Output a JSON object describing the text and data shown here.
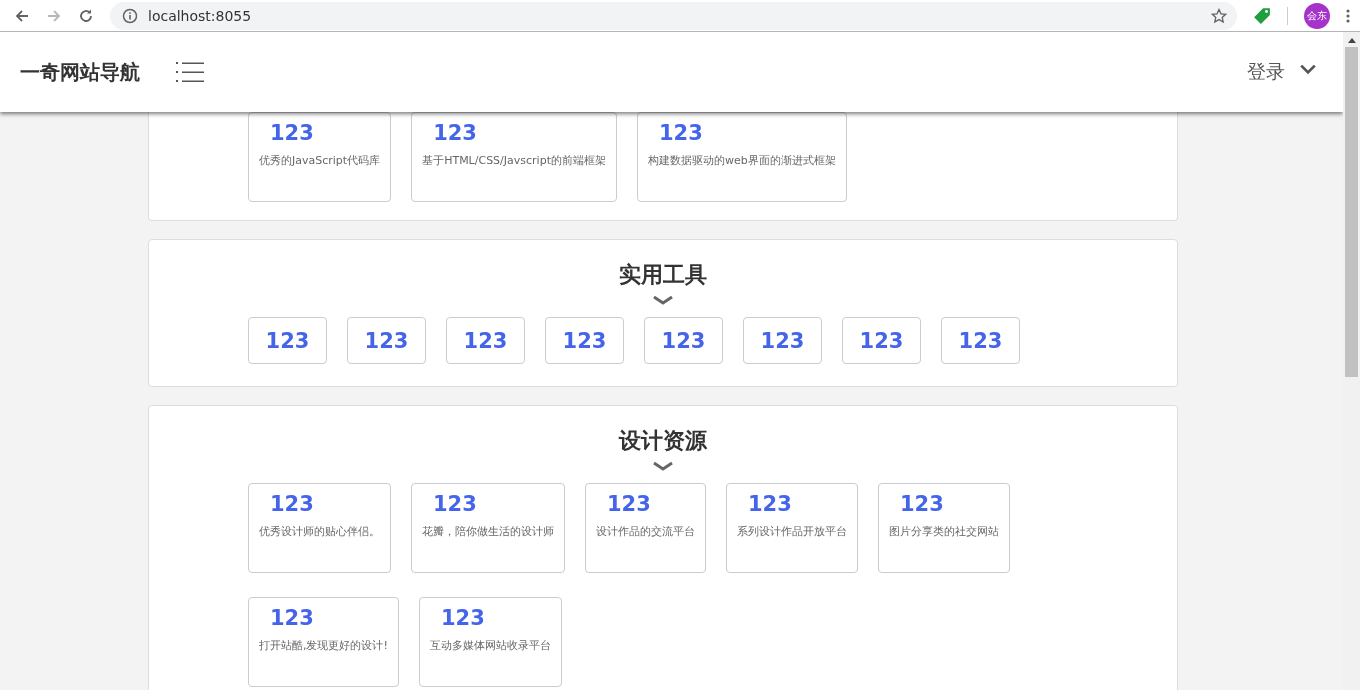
{
  "browser": {
    "address": "localhost:8055",
    "avatar": "会东",
    "forward_disabled": true
  },
  "header": {
    "title": "一奇网站导航",
    "login": "登录"
  },
  "sections": [
    {
      "cards": [
        {
          "title": "123",
          "desc": "优秀的JavaScript代码库"
        },
        {
          "title": "123",
          "desc": "基于HTML/CSS/Javscript的前端框架"
        },
        {
          "title": "123",
          "desc": "构建数据驱动的web界面的渐进式框架"
        }
      ]
    },
    {
      "title": "实用工具",
      "cards": [
        {
          "title": "123"
        },
        {
          "title": "123"
        },
        {
          "title": "123"
        },
        {
          "title": "123"
        },
        {
          "title": "123"
        },
        {
          "title": "123"
        },
        {
          "title": "123"
        },
        {
          "title": "123"
        }
      ]
    },
    {
      "title": "设计资源",
      "cards": [
        {
          "title": "123",
          "desc": "优秀设计师的贴心伴侣。"
        },
        {
          "title": "123",
          "desc": "花瓣，陪你做生活的设计师"
        },
        {
          "title": "123",
          "desc": "设计作品的交流平台"
        },
        {
          "title": "123",
          "desc": "系列设计作品开放平台"
        },
        {
          "title": "123",
          "desc": "图片分享类的社交网站"
        },
        {
          "title": "123",
          "desc": "打开站酷,发现更好的设计!"
        },
        {
          "title": "123",
          "desc": "互动多媒体网站收录平台"
        }
      ]
    }
  ]
}
